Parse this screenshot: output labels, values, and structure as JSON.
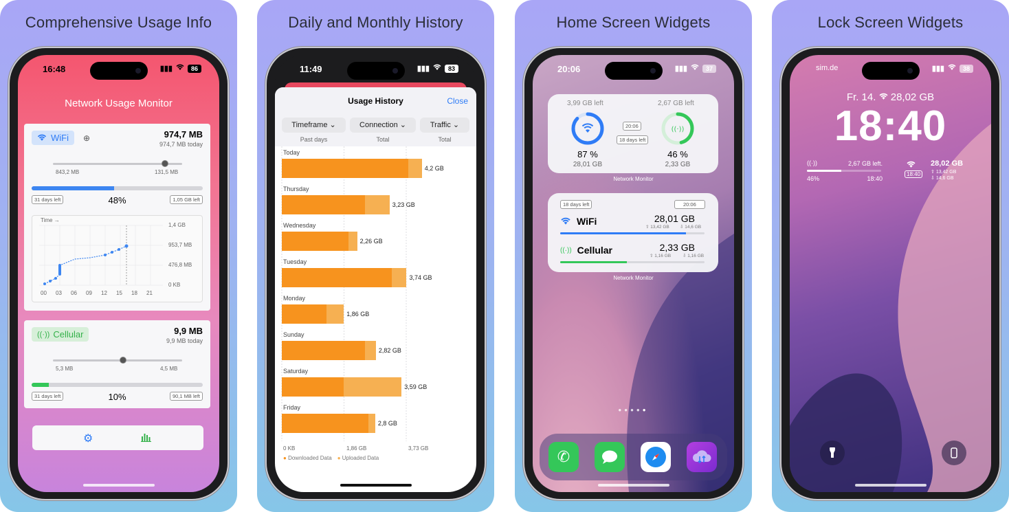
{
  "panel1": {
    "title": "Comprehensive Usage Info",
    "time": "16:48",
    "battery": "86",
    "app_title": "Network Usage Monitor",
    "wifi": {
      "label": "WiFi",
      "total": "974,7 MB",
      "today": "974,7 MB today",
      "dl": "843,2 MB",
      "ul": "131,5 MB",
      "days_left": "31 days left",
      "percent": "48%",
      "fraction": 0.48,
      "left": "1,05 GB left",
      "chart_time_label": "Time →",
      "y_ticks": [
        "1,4 GB",
        "953,7 MB",
        "476,8 MB",
        "0 KB"
      ],
      "x_ticks": [
        "00",
        "03",
        "06",
        "09",
        "12",
        "15",
        "18",
        "21"
      ]
    },
    "cellular": {
      "label": "Cellular",
      "total": "9,9 MB",
      "today": "9,9 MB today",
      "dl": "5,3 MB",
      "ul": "4,5 MB",
      "days_left": "31 days left",
      "percent": "10%",
      "fraction": 0.1,
      "left": "90,1 MB left"
    },
    "tabbar": [
      "gear-icon",
      "chart-icon"
    ]
  },
  "panel2": {
    "title": "Daily and Monthly History",
    "time": "11:49",
    "battery": "83",
    "sheet_title": "Usage History",
    "close": "Close",
    "filters": [
      {
        "label": "Timeframe",
        "sub": "Past days"
      },
      {
        "label": "Connection",
        "sub": "Total"
      },
      {
        "label": "Traffic",
        "sub": "Total"
      }
    ],
    "x_ticks": [
      "0 KB",
      "1,86 GB",
      "3,73 GB"
    ],
    "legend": [
      "Downloaded Data",
      "Uploaded Data"
    ],
    "colors": {
      "download": "#f7931e",
      "upload": "#f6b052"
    }
  },
  "chart_data": {
    "type": "bar",
    "orientation": "horizontal",
    "stacked": true,
    "categories": [
      "Today",
      "Thursday",
      "Wednesday",
      "Tuesday",
      "Monday",
      "Sunday",
      "Saturday",
      "Friday"
    ],
    "value_labels": [
      "4,2 GB",
      "3,23 GB",
      "2,26 GB",
      "3,74 GB",
      "1,86 GB",
      "2,82 GB",
      "3,59 GB",
      "2,8 GB"
    ],
    "series": [
      {
        "name": "Downloaded Data",
        "values": [
          3.8,
          2.5,
          2.0,
          3.3,
          1.34,
          2.5,
          1.85,
          2.6
        ]
      },
      {
        "name": "Uploaded Data",
        "values": [
          0.4,
          0.73,
          0.26,
          0.44,
          0.52,
          0.32,
          1.74,
          0.2
        ]
      }
    ],
    "xlim": [
      0,
      3.73
    ],
    "x_ticks": [
      "0 KB",
      "1,86 GB",
      "3,73 GB"
    ]
  },
  "panel3": {
    "title": "Home Screen Widgets",
    "time": "20:06",
    "battery": "37",
    "w1": {
      "wifi_left": "3,99 GB left",
      "cell_left": "2,67 GB left",
      "clock": "20:06",
      "days": "18 days left",
      "wifi_pct": "87 %",
      "wifi_fraction": 0.87,
      "wifi_total": "28,01 GB",
      "cell_pct": "46 %",
      "cell_fraction": 0.46,
      "cell_total": "2,33 GB",
      "caption": "Network Monitor"
    },
    "w2": {
      "days": "18 days left",
      "clock": "20:06",
      "wifi_label": "WiFi",
      "wifi_total": "28,01 GB",
      "wifi_ul": "13,42 GB",
      "wifi_dl": "14,6 GB",
      "wifi_fraction": 0.87,
      "cell_label": "Cellular",
      "cell_total": "2,33 GB",
      "cell_ul": "1,16 GB",
      "cell_dl": "1,16 GB",
      "cell_fraction": 0.46,
      "caption": "Network Monitor"
    },
    "dock": [
      "phone-icon",
      "messages-icon",
      "safari-icon",
      "network-monitor-app-icon"
    ]
  },
  "panel4": {
    "title": "Lock Screen Widgets",
    "carrier": "sim.de",
    "battery": "38",
    "date_line": "Fr. 14.",
    "date_data": "28,02 GB",
    "clock": "18:40",
    "lw1": {
      "left": "2,67 GB left.",
      "percent": "46%",
      "time": "18:40",
      "fraction": 0.46
    },
    "lw2": {
      "time": "18:40",
      "total": "28,02 GB",
      "ul": "13,42 GB",
      "dl": "14,6 GB"
    }
  }
}
